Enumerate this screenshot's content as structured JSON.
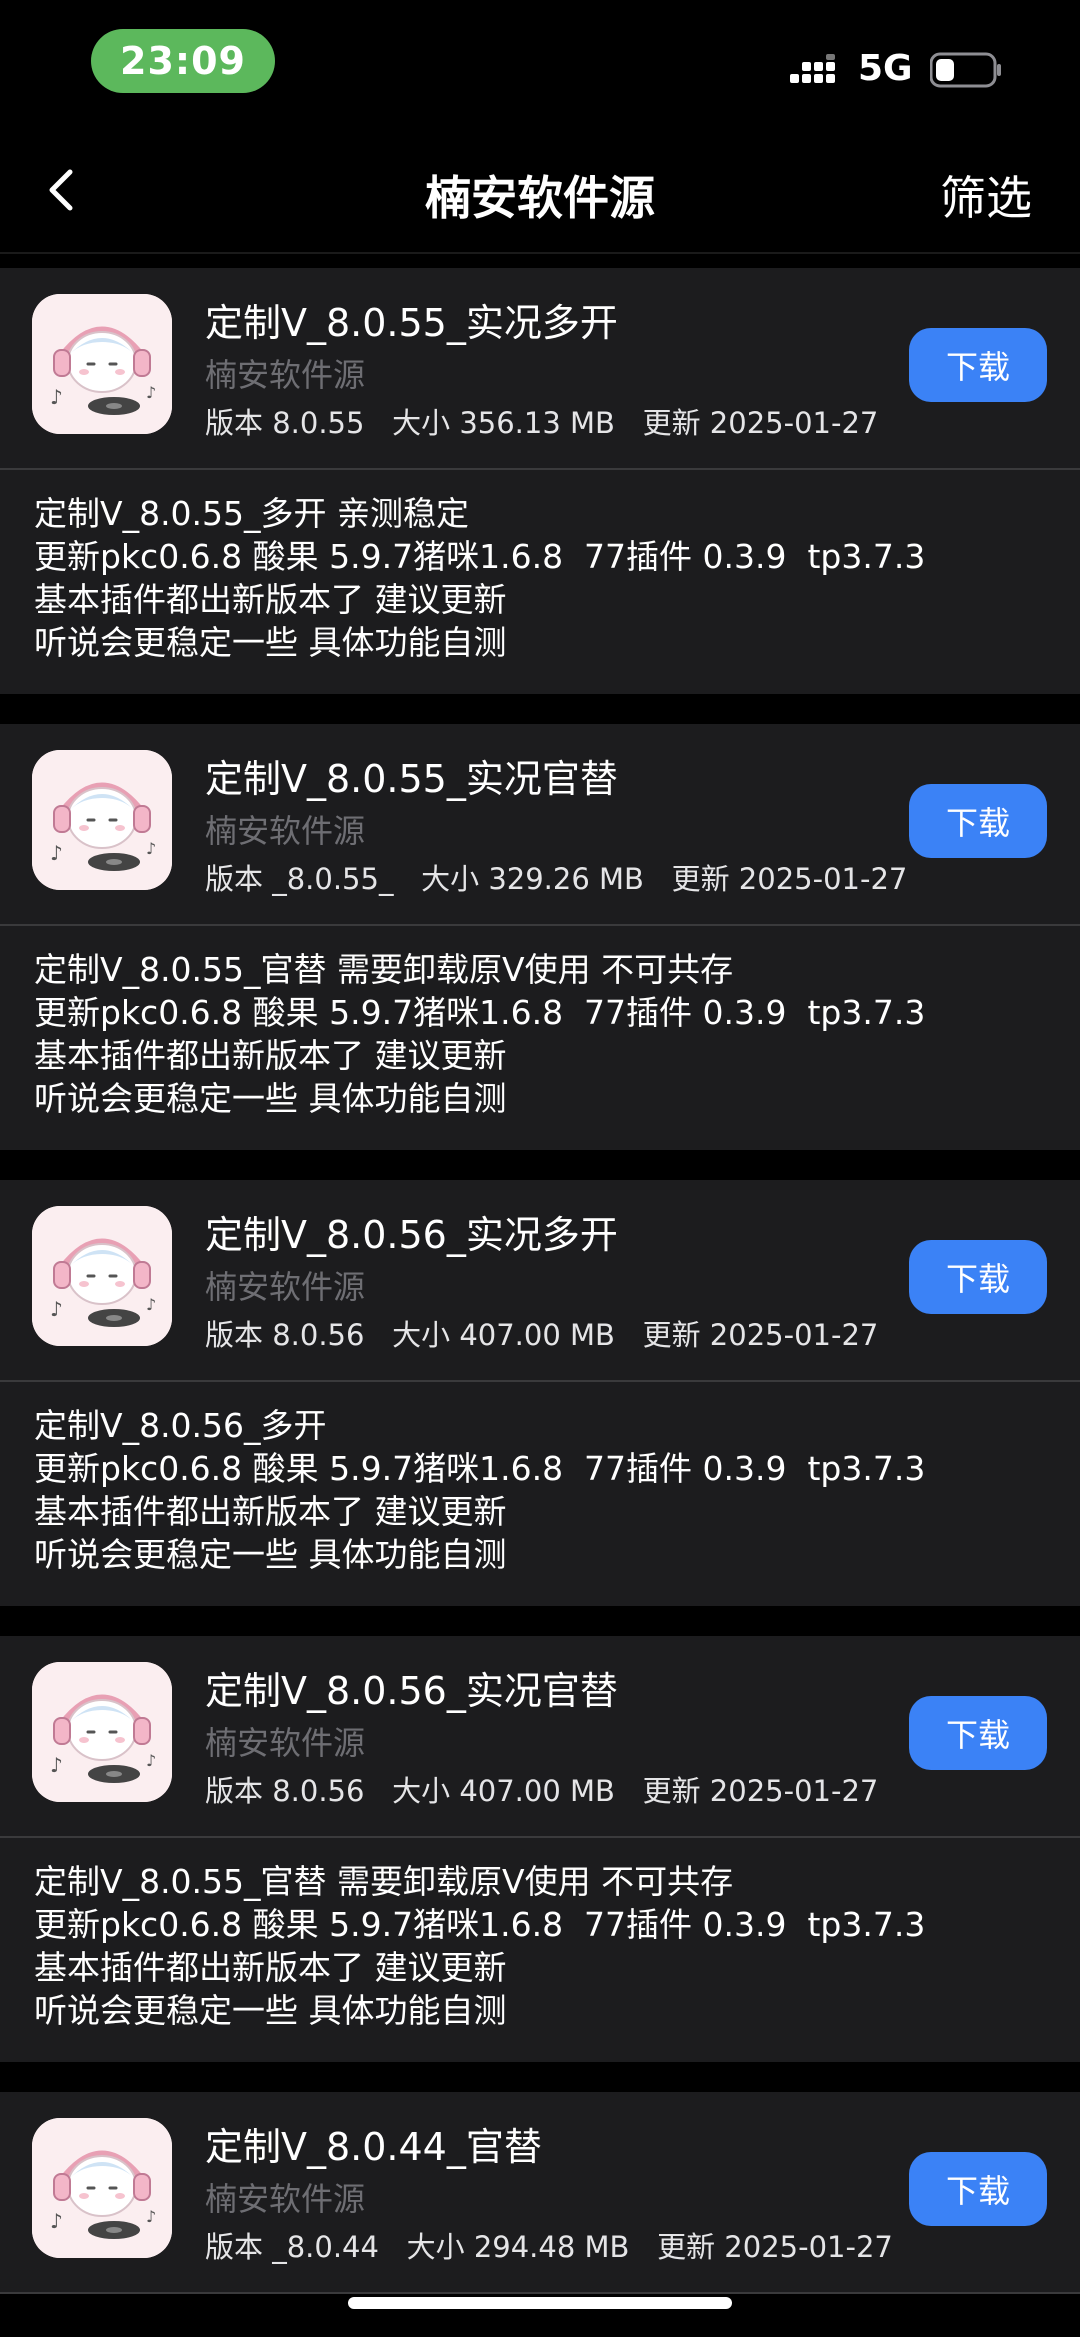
{
  "status_bar": {
    "time": "23:09",
    "network": "5G",
    "accent": "#5cb85c"
  },
  "nav": {
    "title": "楠安软件源",
    "filter_label": "筛选",
    "back_icon": "chevron-left-icon"
  },
  "download_label": "下载",
  "colors": {
    "background": "#000000",
    "card": "#1c1c1e",
    "button": "#3b82f6",
    "muted_text": "#6e6e73"
  },
  "apps": [
    {
      "title": "定制V_8.0.55_实况多开",
      "source": "楠安软件源",
      "meta": "版本 8.0.55   大小 356.13 MB   更新 2025-01-27",
      "description": [
        "定制V_8.0.55_多开 亲测稳定",
        "更新pkc0.6.8 酸果 5.9.7猪咪1.6.8  77插件 0.3.9  tp3.7.3",
        "基本插件都出新版本了 建议更新",
        "听说会更稳定一些 具体功能自测"
      ]
    },
    {
      "title": "定制V_8.0.55_实况官替",
      "source": "楠安软件源",
      "meta": "版本 _8.0.55_   大小 329.26 MB   更新 2025-01-27",
      "description": [
        "定制V_8.0.55_官替 需要卸载原V使用 不可共存",
        "更新pkc0.6.8 酸果 5.9.7猪咪1.6.8  77插件 0.3.9  tp3.7.3",
        "基本插件都出新版本了 建议更新",
        "听说会更稳定一些 具体功能自测"
      ]
    },
    {
      "title": "定制V_8.0.56_实况多开",
      "source": "楠安软件源",
      "meta": "版本 8.0.56   大小 407.00 MB   更新 2025-01-27",
      "description": [
        "定制V_8.0.56_多开",
        "更新pkc0.6.8 酸果 5.9.7猪咪1.6.8  77插件 0.3.9  tp3.7.3",
        "基本插件都出新版本了 建议更新",
        "听说会更稳定一些 具体功能自测"
      ]
    },
    {
      "title": "定制V_8.0.56_实况官替",
      "source": "楠安软件源",
      "meta": "版本 8.0.56   大小 407.00 MB   更新 2025-01-27",
      "description": [
        "定制V_8.0.55_官替 需要卸载原V使用 不可共存",
        "更新pkc0.6.8 酸果 5.9.7猪咪1.6.8  77插件 0.3.9  tp3.7.3",
        "基本插件都出新版本了 建议更新",
        "听说会更稳定一些 具体功能自测"
      ]
    },
    {
      "title": "定制V_8.0.44_官替",
      "source": "楠安软件源",
      "meta": "版本 _8.0.44   大小 294.48 MB   更新 2025-01-27",
      "description": []
    }
  ]
}
